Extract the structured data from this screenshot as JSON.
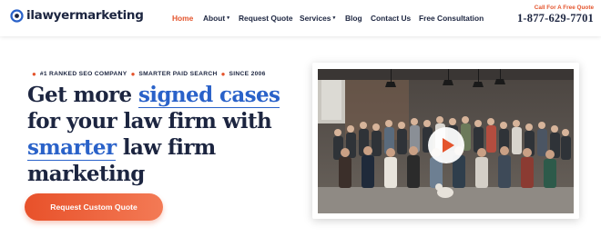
{
  "brand": {
    "name": "ilawyermarketing",
    "color": "#1c2540",
    "accent": "#e4542c",
    "link_blue": "#2a62c9"
  },
  "nav": {
    "items": [
      {
        "label": "Home",
        "active": true,
        "dropdown": false
      },
      {
        "label": "About",
        "active": false,
        "dropdown": true
      },
      {
        "label": "Request Quote",
        "active": false,
        "dropdown": false
      },
      {
        "label": "Services",
        "active": false,
        "dropdown": true
      },
      {
        "label": "Blog",
        "active": false,
        "dropdown": false
      },
      {
        "label": "Contact Us",
        "active": false,
        "dropdown": false
      },
      {
        "label": "Free Consultation",
        "active": false,
        "dropdown": false
      }
    ],
    "caret": "▾"
  },
  "header_cta": {
    "label": "Call For A Free Quote",
    "phone": "1-877-629-7701"
  },
  "hero": {
    "badges": [
      "#1 RANKED SEO COMPANY",
      "SMARTER PAID SEARCH",
      "SINCE 2006"
    ],
    "badge_separator": "●",
    "headline": {
      "p1": "Get more ",
      "h1": "signed cases",
      "p2": "for your law firm with",
      "h2": "smarter",
      "p3": " law firm",
      "p4": "marketing"
    },
    "cta_label": "Request Custom Quote"
  },
  "video": {
    "play_icon": "play-icon"
  }
}
